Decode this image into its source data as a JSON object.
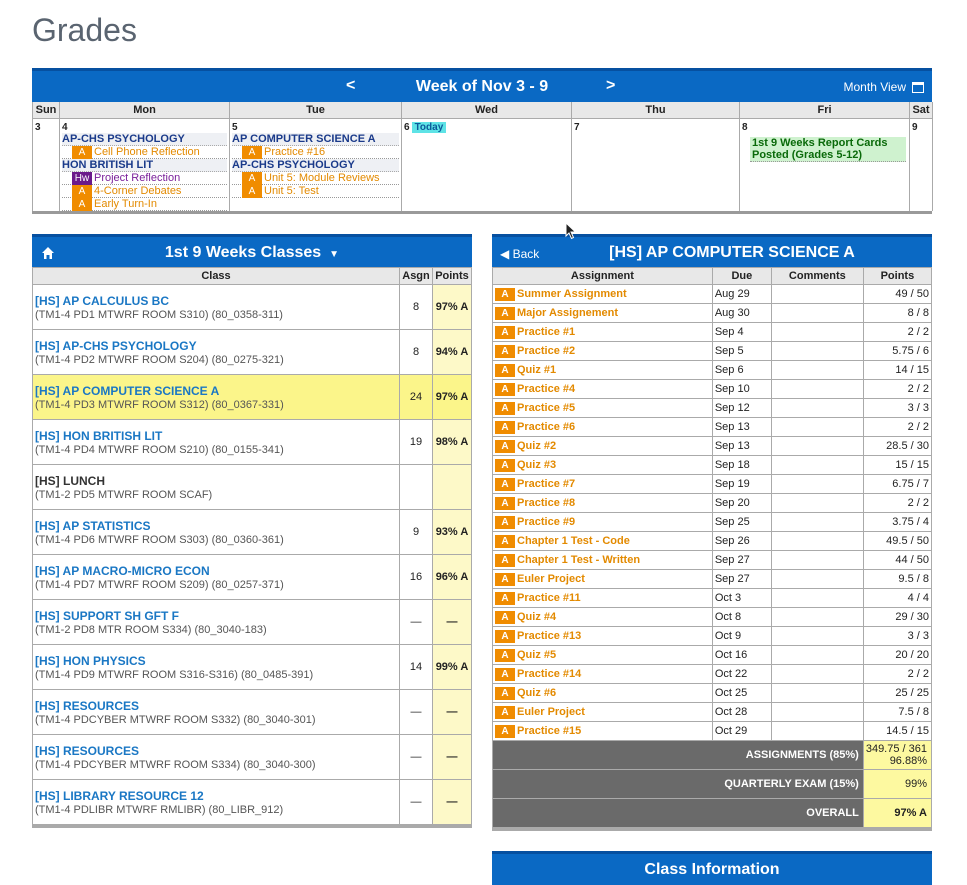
{
  "page": {
    "title": "Grades"
  },
  "calendar": {
    "prev": "<",
    "next": ">",
    "title": "Week of Nov 3 - 9",
    "month_view": "Month View",
    "days": [
      "Sun",
      "Mon",
      "Tue",
      "Wed",
      "Thu",
      "Fri",
      "Sat"
    ],
    "dates": [
      "3",
      "4",
      "5",
      "6",
      "7",
      "8",
      "9"
    ],
    "today_label": "Today",
    "mon": [
      {
        "type": "class",
        "text": "AP-CHS PSYCHOLOGY"
      },
      {
        "type": "item",
        "tag": "A",
        "text": "Cell Phone Reflection"
      },
      {
        "type": "class",
        "text": "HON BRITISH LIT"
      },
      {
        "type": "item",
        "tag": "Hw",
        "text": "Project Reflection",
        "purple": true
      },
      {
        "type": "item",
        "tag": "A",
        "text": "4-Corner Debates"
      },
      {
        "type": "item",
        "tag": "A",
        "text": "Early Turn-In"
      }
    ],
    "tue": [
      {
        "type": "class",
        "text": "AP COMPUTER SCIENCE A"
      },
      {
        "type": "item",
        "tag": "A",
        "text": "Practice #16"
      },
      {
        "type": "class",
        "text": "AP-CHS PSYCHOLOGY"
      },
      {
        "type": "item",
        "tag": "A",
        "text": "Unit 5: Module Reviews"
      },
      {
        "type": "item",
        "tag": "A",
        "text": "Unit 5: Test"
      }
    ],
    "fri_event": "1st 9 Weeks Report Cards Posted (Grades 5-12)"
  },
  "classes": {
    "title": "1st 9 Weeks Classes",
    "dropdown": "▼",
    "headers": [
      "Class",
      "Asgn",
      "Points"
    ],
    "rows": [
      {
        "name": "[HS] AP CALCULUS BC",
        "sub": "(TM1-4 PD1 MTWRF ROOM S310) (80_0358-311)",
        "asgn": "8",
        "pts": "97% A"
      },
      {
        "name": "[HS] AP-CHS PSYCHOLOGY",
        "sub": "(TM1-4 PD2 MTWRF ROOM S204) (80_0275-321)",
        "asgn": "8",
        "pts": "94% A"
      },
      {
        "name": "[HS] AP COMPUTER SCIENCE A",
        "sub": "(TM1-4 PD3 MTWRF ROOM S312) (80_0367-331)",
        "asgn": "24",
        "pts": "97% A",
        "selected": true
      },
      {
        "name": "[HS] HON BRITISH LIT",
        "sub": "(TM1-4 PD4 MTWRF ROOM S210) (80_0155-341)",
        "asgn": "19",
        "pts": "98% A"
      },
      {
        "name": "[HS] LUNCH",
        "sub": "(TM1-2 PD5 MTWRF ROOM SCAF)",
        "asgn": "",
        "pts": "",
        "plain": true
      },
      {
        "name": "[HS] AP STATISTICS",
        "sub": "(TM1-4 PD6 MTWRF ROOM S303) (80_0360-361)",
        "asgn": "9",
        "pts": "93% A"
      },
      {
        "name": "[HS] AP MACRO-MICRO ECON",
        "sub": "(TM1-4 PD7 MTWRF ROOM S209) (80_0257-371)",
        "asgn": "16",
        "pts": "96% A"
      },
      {
        "name": "[HS] SUPPORT SH GFT F",
        "sub": "(TM1-2 PD8 MTR ROOM S334) (80_3040-183)",
        "asgn": "—",
        "pts": "—"
      },
      {
        "name": "[HS] HON PHYSICS",
        "sub": "(TM1-4 PD9 MTWRF ROOM S316-S316) (80_0485-391)",
        "asgn": "14",
        "pts": "99% A"
      },
      {
        "name": "[HS] RESOURCES",
        "sub": "(TM1-4 PDCYBER MTWRF ROOM S332) (80_3040-301)",
        "asgn": "—",
        "pts": "—"
      },
      {
        "name": "[HS] RESOURCES",
        "sub": "(TM1-4 PDCYBER MTWRF ROOM S334) (80_3040-300)",
        "asgn": "—",
        "pts": "—"
      },
      {
        "name": "[HS] LIBRARY RESOURCE 12",
        "sub": "(TM1-4 PDLIBR MTWRF RMLIBR) (80_LIBR_912)",
        "asgn": "—",
        "pts": "—"
      }
    ]
  },
  "assignments": {
    "back": "◀ Back",
    "title": "[HS] AP COMPUTER SCIENCE A",
    "headers": [
      "Assignment",
      "Due",
      "Comments",
      "Points"
    ],
    "rows": [
      {
        "tag": "A",
        "name": "Summer Assignment",
        "due": "Aug 29",
        "pts": "49 / 50"
      },
      {
        "tag": "A",
        "name": "Major Assignement",
        "due": "Aug 30",
        "pts": "8 / 8"
      },
      {
        "tag": "A",
        "name": "Practice #1",
        "due": "Sep 4",
        "pts": "2 / 2"
      },
      {
        "tag": "A",
        "name": "Practice #2",
        "due": "Sep 5",
        "pts": "5.75 / 6"
      },
      {
        "tag": "A",
        "name": "Quiz #1",
        "due": "Sep 6",
        "pts": "14 / 15"
      },
      {
        "tag": "A",
        "name": "Practice #4",
        "due": "Sep 10",
        "pts": "2 / 2"
      },
      {
        "tag": "A",
        "name": "Practice #5",
        "due": "Sep 12",
        "pts": "3 / 3"
      },
      {
        "tag": "A",
        "name": "Practice #6",
        "due": "Sep 13",
        "pts": "2 / 2"
      },
      {
        "tag": "A",
        "name": "Quiz #2",
        "due": "Sep 13",
        "pts": "28.5 / 30"
      },
      {
        "tag": "A",
        "name": "Quiz #3",
        "due": "Sep 18",
        "pts": "15 / 15"
      },
      {
        "tag": "A",
        "name": "Practice #7",
        "due": "Sep 19",
        "pts": "6.75 / 7"
      },
      {
        "tag": "A",
        "name": "Practice #8",
        "due": "Sep 20",
        "pts": "2 / 2"
      },
      {
        "tag": "A",
        "name": "Practice #9",
        "due": "Sep 25",
        "pts": "3.75 / 4"
      },
      {
        "tag": "A",
        "name": "Chapter 1 Test - Code",
        "due": "Sep 26",
        "pts": "49.5 / 50"
      },
      {
        "tag": "A",
        "name": "Chapter 1 Test - Written",
        "due": "Sep 27",
        "pts": "44 / 50"
      },
      {
        "tag": "A",
        "name": "Euler Project",
        "due": "Sep 27",
        "pts": "9.5 / 8"
      },
      {
        "tag": "A",
        "name": "Practice #11",
        "due": "Oct 3",
        "pts": "4 / 4"
      },
      {
        "tag": "A",
        "name": "Quiz #4",
        "due": "Oct 8",
        "pts": "29 / 30"
      },
      {
        "tag": "A",
        "name": "Practice #13",
        "due": "Oct 9",
        "pts": "3 / 3"
      },
      {
        "tag": "A",
        "name": "Quiz #5",
        "due": "Oct 16",
        "pts": "20 / 20"
      },
      {
        "tag": "A",
        "name": "Practice #14",
        "due": "Oct 22",
        "pts": "2 / 2"
      },
      {
        "tag": "A",
        "name": "Quiz #6",
        "due": "Oct 25",
        "pts": "25 / 25"
      },
      {
        "tag": "A",
        "name": "Euler Project",
        "due": "Oct 28",
        "pts": "7.5 / 8"
      },
      {
        "tag": "A",
        "name": "Practice #15",
        "due": "Oct 29",
        "pts": "14.5 / 15"
      }
    ],
    "summary": [
      {
        "label": "ASSIGNMENTS (85%)",
        "value": "349.75 / 361",
        "value2": "96.88%"
      },
      {
        "label": "QUARTERLY EXAM (15%)",
        "value": "99%",
        "value2": ""
      },
      {
        "label": "OVERALL",
        "value": "97% A",
        "value2": "",
        "bold": true
      }
    ]
  },
  "class_info": {
    "title": "Class Information"
  },
  "colors": {
    "header_blue": "#0a69c4",
    "assignment_orange": "#e38a00",
    "points_yellow": "#fdf9c8",
    "selected_row": "#fbf58a"
  }
}
